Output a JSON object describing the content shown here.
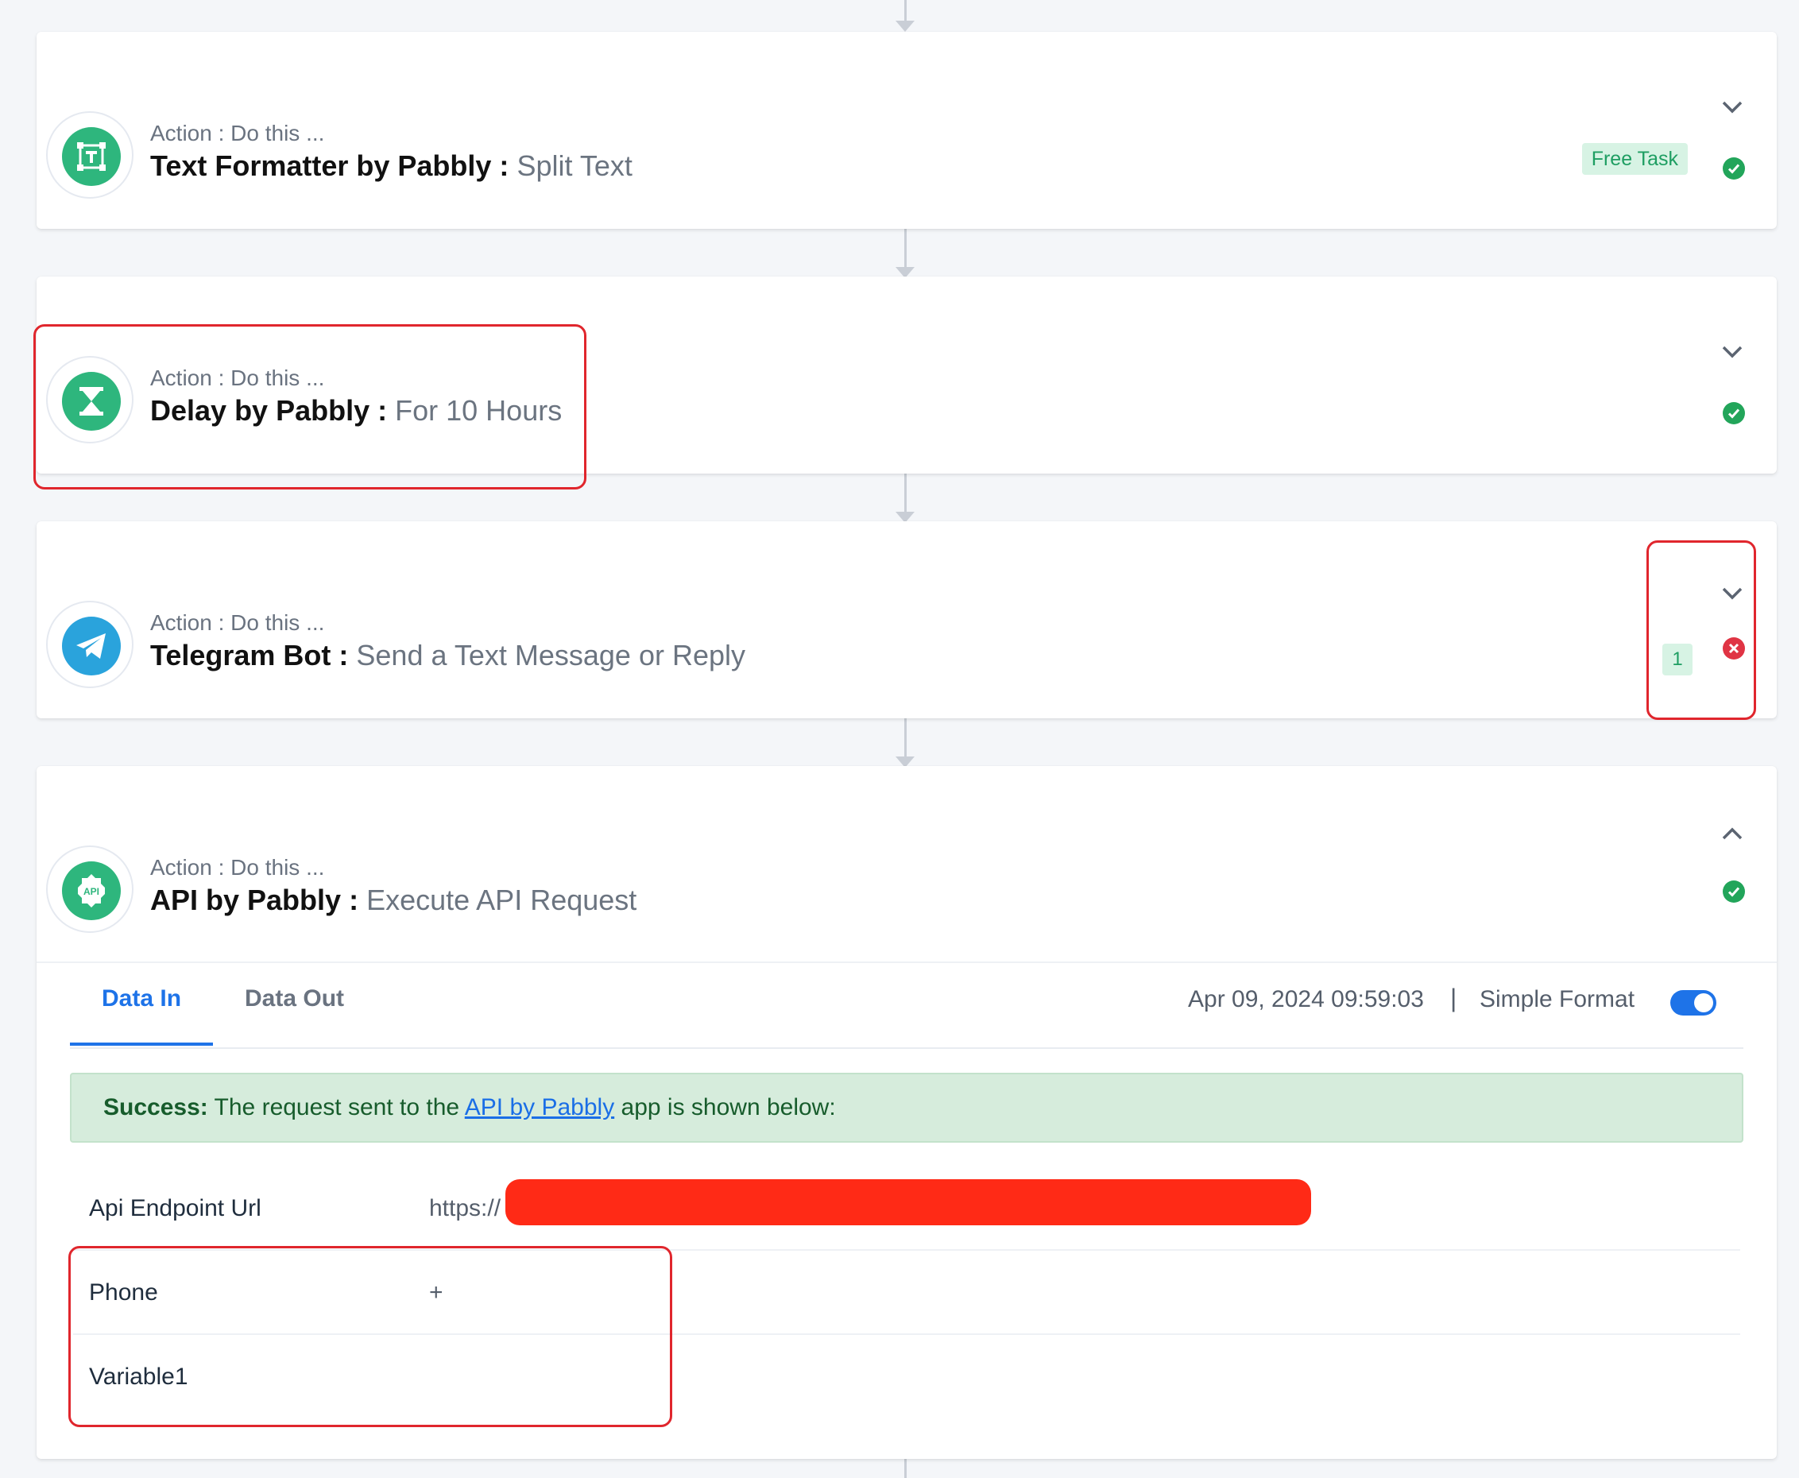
{
  "steps": [
    {
      "label": "Action : Do this ...",
      "app_name": "Text Formatter by Pabbly :",
      "action": "Split Text",
      "icon": "text-formatter-icon",
      "badge": "Free Task",
      "status": "success"
    },
    {
      "label": "Action : Do this ...",
      "app_name": "Delay by Pabbly :",
      "action": "For 10 Hours",
      "icon": "hourglass-icon",
      "status": "success"
    },
    {
      "label": "Action : Do this ...",
      "app_name": "Telegram Bot :",
      "action": "Send a Text Message or Reply",
      "icon": "telegram-icon",
      "badge_count": "1",
      "status": "error"
    },
    {
      "label": "Action : Do this ...",
      "app_name": "API by Pabbly :",
      "action": "Execute API Request",
      "icon": "api-icon",
      "icon_text": "API",
      "status": "success"
    }
  ],
  "details": {
    "tabs": [
      "Data In",
      "Data Out"
    ],
    "active_tab": "Data In",
    "timestamp": "Apr 09, 2024 09:59:03",
    "separator": "|",
    "format_label": "Simple Format",
    "format_toggle": true,
    "alert": {
      "strong": "Success:",
      "text_before": " The request sent to the ",
      "link": "API by Pabbly",
      "text_after": " app is shown below:"
    },
    "rows": [
      {
        "key": "Api Endpoint Url",
        "value": "https://"
      },
      {
        "key": "Phone",
        "value": "+"
      },
      {
        "key": "Variable1",
        "value": ""
      }
    ]
  },
  "colors": {
    "brand_green": "#2eb67d",
    "telegram_blue": "#2aa3dc",
    "link_blue": "#1e73e8",
    "success": "#22a55a",
    "error": "#e03444",
    "highlight_red": "#e0262d"
  }
}
